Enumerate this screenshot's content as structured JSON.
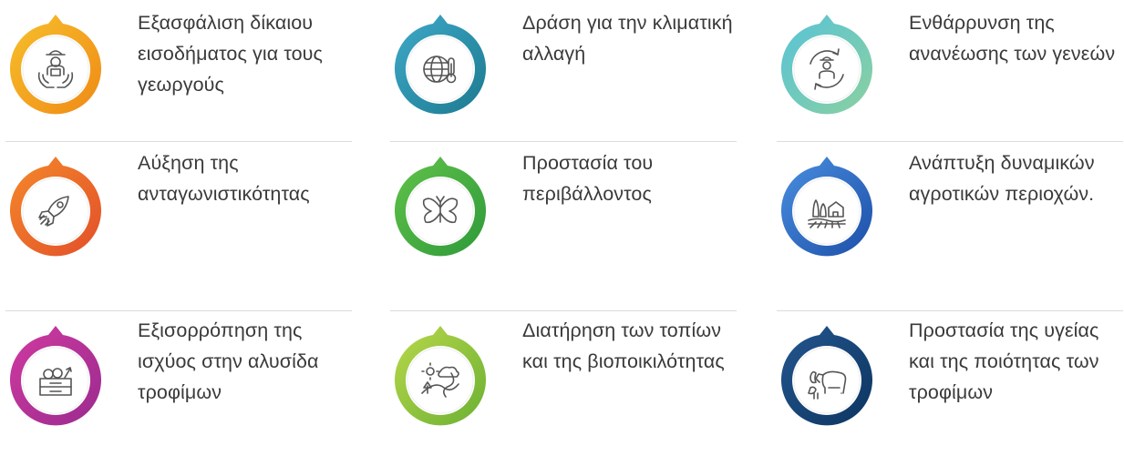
{
  "items": [
    {
      "label": "Εξασφάλιση δίκαιου εισοδήματος για τους γεωργούς",
      "icon": "farmer-hands-icon",
      "colors": [
        "#f7c02b",
        "#ef8a16"
      ]
    },
    {
      "label": "Δράση για την κλιματική αλλαγή",
      "icon": "globe-thermometer-icon",
      "colors": [
        "#3fa9c9",
        "#1c7a8f"
      ]
    },
    {
      "label": "Ενθάρρυνση της ανανέωσης των γενεών",
      "icon": "farmer-cycle-icon",
      "colors": [
        "#57c3d8",
        "#8bd0a0"
      ]
    },
    {
      "label": "Αύξηση της ανταγωνιστικότητας",
      "icon": "rocket-icon",
      "colors": [
        "#f4892a",
        "#e24f2a"
      ]
    },
    {
      "label": "Προστασία του περιβάλλοντος",
      "icon": "butterfly-icon",
      "colors": [
        "#62c24a",
        "#2e9a3a"
      ]
    },
    {
      "label": "Ανάπτυξη δυναμικών αγροτικών περιοχών.",
      "icon": "rural-landscape-icon",
      "colors": [
        "#4a8fe0",
        "#1d4fa8"
      ]
    },
    {
      "label": "Εξισορρόπηση της ισχύος στην αλυσίδα τροφίμων",
      "icon": "food-crate-icon",
      "colors": [
        "#d03aa0",
        "#9a2b8f"
      ]
    },
    {
      "label": "Διατήρηση των τοπίων και της βιοποικιλότητας",
      "icon": "landscape-biodiversity-icon",
      "colors": [
        "#b9d84a",
        "#6bb033"
      ]
    },
    {
      "label": "Προστασία της υγείας και της ποιότητας των τροφίμων",
      "icon": "livestock-icon",
      "colors": [
        "#23568f",
        "#0d3560"
      ]
    }
  ]
}
